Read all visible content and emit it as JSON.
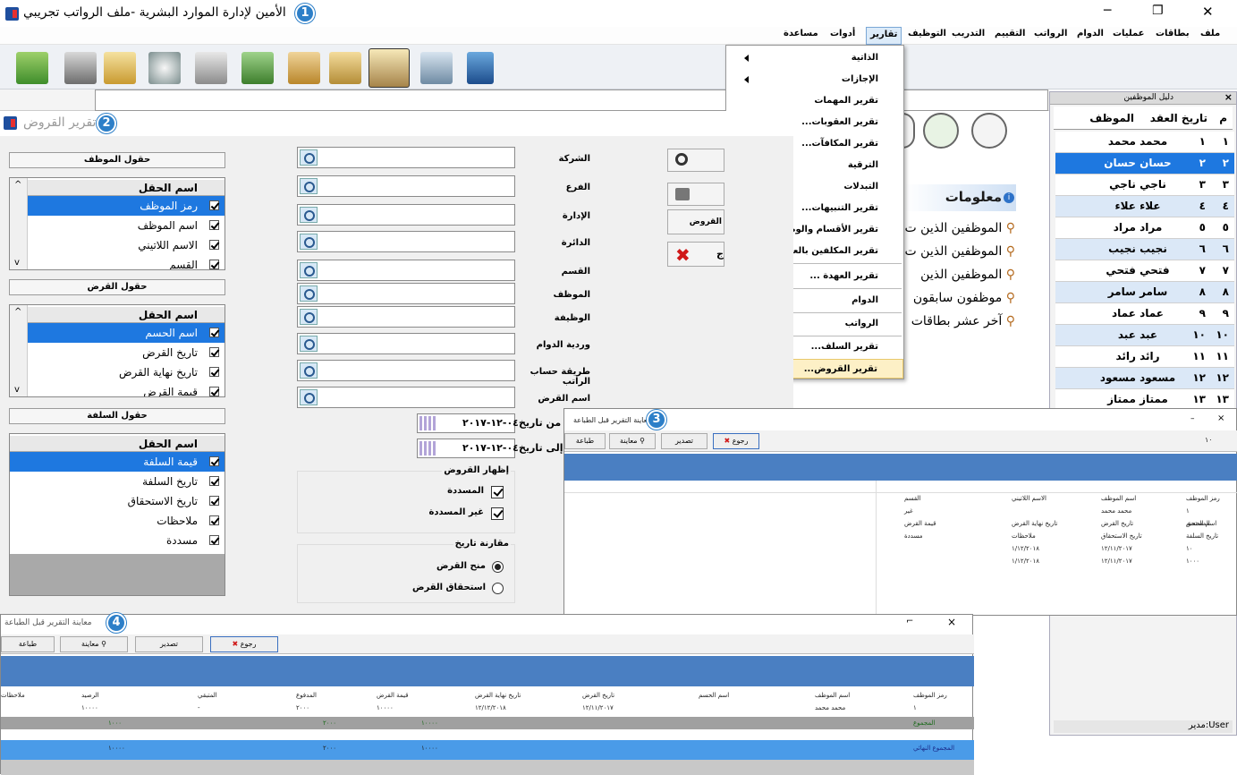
{
  "titlebar": {
    "title": "الأمين لإدارة الموارد البشرية -ملف الرواتب تجريبي",
    "badge": "1",
    "minimize": "─",
    "maximize": "❐",
    "close": "✕"
  },
  "menubar": {
    "items": [
      "ملف",
      "بطاقات",
      "عمليات",
      "الدوام",
      "الرواتب",
      "التقييم",
      "التدريب",
      "التوظيف",
      "تقارير",
      "أدوات",
      "مساعدة"
    ]
  },
  "dropdown": {
    "items": [
      "الذاتية",
      "الإجازات",
      "تقرير المهمات",
      "تقرير العقوبات...",
      "تقرير المكافآت...",
      "الترقية",
      "التبدلات",
      "تقرير التنبيهات...",
      "تقرير الأقسام والوظائف ...",
      "تقرير المكلفين بالعمل الإضافي...",
      "تقرير العهدة ...",
      "الدوام",
      "الرواتب",
      "تقرير السلف...",
      "تقرير القروض..."
    ]
  },
  "emp_panel": {
    "title": "دليل الموظفين",
    "close": "×",
    "headers": {
      "num": "م",
      "contract": "تاريخ العقد",
      "name": "الموظف"
    },
    "rows": [
      {
        "num": "١",
        "contract": "١",
        "name": "محمد محمد"
      },
      {
        "num": "٢",
        "contract": "٢",
        "name": "حسان حسان"
      },
      {
        "num": "٣",
        "contract": "٣",
        "name": "ناجي ناجي"
      },
      {
        "num": "٤",
        "contract": "٤",
        "name": "علاء علاء"
      },
      {
        "num": "٥",
        "contract": "٥",
        "name": "مراد مراد"
      },
      {
        "num": "٦",
        "contract": "٦",
        "name": "نجيب نجيب"
      },
      {
        "num": "٧",
        "contract": "٧",
        "name": "فتحي فتحي"
      },
      {
        "num": "٨",
        "contract": "٨",
        "name": "سامر سامر"
      },
      {
        "num": "٩",
        "contract": "٩",
        "name": "عماد عماد"
      },
      {
        "num": "١٠",
        "contract": "١٠",
        "name": "عبد عبد"
      },
      {
        "num": "١١",
        "contract": "١١",
        "name": "رائد رائد"
      },
      {
        "num": "١٢",
        "contract": "١٢",
        "name": "مسعود مسعود"
      },
      {
        "num": "١٣",
        "contract": "١٣",
        "name": "ممتاز ممتاز"
      }
    ],
    "status_user": "User:مدير"
  },
  "info": {
    "title": "معلومات",
    "lines": [
      "الموظفين الذين ت",
      "الموظفين الذين ت",
      "الموظفين الذين",
      "موظفون سابقون",
      "آخر عشر بطاقات"
    ]
  },
  "loans": {
    "title": "تقرير القروض",
    "badge": "2",
    "fields": [
      "الشركة",
      "الفرع",
      "الإدارة",
      "الدائرة",
      "القسم",
      "الموظف",
      "الوظيفة",
      "وردية الدوام",
      "طريقة حساب الراتب",
      "اسم القرض"
    ],
    "from_date_label": "من تاريخ",
    "to_date_label": "إلى تاريخ",
    "from_date": "٠٤-١٢-٢٠١٧",
    "to_date": "٠٤-١٢-٢٠١٧",
    "show_loans": {
      "title": "إظهار القروض",
      "opt1": "المسددة",
      "opt2": "غير المسددة"
    },
    "compare": {
      "title": "مقارنة تاريخ",
      "opt1": "منح القرض",
      "opt2": "استحقاق القرض"
    },
    "buttons": {
      "preview": "القروض",
      "exit": "ج"
    },
    "employee_fields": {
      "title": "حقول الموظف",
      "header": "اسم الحقل",
      "items": [
        "رمز الموظف",
        "اسم الموظف",
        "الاسم اللاتيني",
        "القسم"
      ]
    },
    "loan_fields": {
      "title": "حقول القرض",
      "header": "اسم الحقل",
      "items": [
        "اسم الحسم",
        "تاريخ القرض",
        "تاريخ نهاية القرض",
        "قيمة القرض"
      ]
    },
    "advance_fields": {
      "title": "حقول السلفة",
      "header": "اسم الحقل",
      "items": [
        "قيمة السلفة",
        "تاريخ السلفة",
        "تاريخ الاستحقاق",
        "ملاحظات",
        "مسددة"
      ]
    }
  },
  "win3": {
    "badge": "3",
    "title": "معاينة التقرير قبل الطباعة",
    "buttons": [
      "رجوع",
      "تصدير",
      "معاينة",
      "طباعة"
    ],
    "page": "١٠",
    "lines": [
      [
        "رمز الموظف",
        "اسم الموظف",
        "الاسم اللاتيني",
        "القسم"
      ],
      [
        "١",
        "محمد محمد",
        "",
        "غير"
      ],
      [
        "اسم الحسم",
        "تاريخ القرض",
        "تاريخ نهاية القرض",
        "قيمة القرض",
        "المستحق"
      ],
      [
        "تاريخ السلفة",
        "تاريخ الاستحقاق",
        "ملاحظات",
        "مسددة"
      ],
      [
        "١٠",
        "١٢/١١/٢٠١٧",
        "١/١٢/٢٠١٨"
      ],
      [
        "١٠٠٠",
        "١٢/١١/٢٠١٧",
        "١/١٢/٢٠١٨"
      ]
    ]
  },
  "win4": {
    "badge": "4",
    "title": "معاينة التقرير قبل الطباعة",
    "buttons": [
      "رجوع",
      "تصدير",
      "معاينة",
      "طباعة"
    ],
    "headers": [
      "رمز الموظف",
      "اسم الموظف",
      "اسم الحسم",
      "تاريخ القرض",
      "تاريخ نهاية القرض",
      "قيمة القرض",
      "المدفوع",
      "المتبقي",
      "الرصيد",
      "ملاحظات"
    ],
    "row": [
      "١",
      "محمد محمد",
      "",
      "١٢/١١/٢٠١٧",
      "١٢/١٢/٢٠١٨",
      "١٠٠٠٠",
      "٢٠٠٠",
      "-",
      "١٠٠٠٠",
      ""
    ],
    "subtotal_label": "المجموع",
    "subtotal": [
      "١٠٠٠٠",
      "٢٠٠٠",
      "",
      "١٠٠٠"
    ],
    "total_label": "المجموع النهائي",
    "total": [
      "١٠٠٠٠",
      "٢٠٠٠",
      "",
      "١٠٠٠٠"
    ]
  }
}
